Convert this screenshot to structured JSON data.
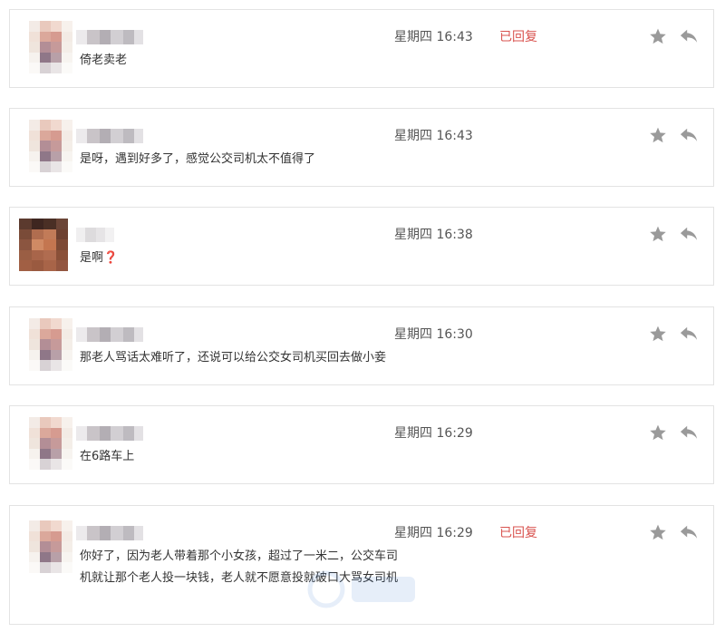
{
  "colors": {
    "status_red": "#d9534f",
    "icon_gray": "#9a9a9a",
    "border": "#e3e3e3"
  },
  "icons": {
    "star": "star-icon",
    "reply": "reply-arrow-icon"
  },
  "messages": [
    {
      "time": "星期四 16:43",
      "status": "已回复",
      "text": "倚老卖老"
    },
    {
      "time": "星期四 16:43",
      "status": "",
      "text": "是呀，遇到好多了，感觉公交司机太不值得了"
    },
    {
      "time": "星期四 16:38",
      "status": "",
      "text": "是啊",
      "emoji": "❓"
    },
    {
      "time": "星期四 16:30",
      "status": "",
      "text": "那老人骂话太难听了，还说可以给公交女司机买回去做小妾"
    },
    {
      "time": "星期四 16:29",
      "status": "",
      "text": "在6路车上"
    },
    {
      "time": "星期四 16:29",
      "status": "已回复",
      "text": "你好了，因为老人带着那个小女孩，超过了一米二，公交车司机就让那个老人投一块钱，老人就不愿意投就破口大骂女司机"
    }
  ]
}
